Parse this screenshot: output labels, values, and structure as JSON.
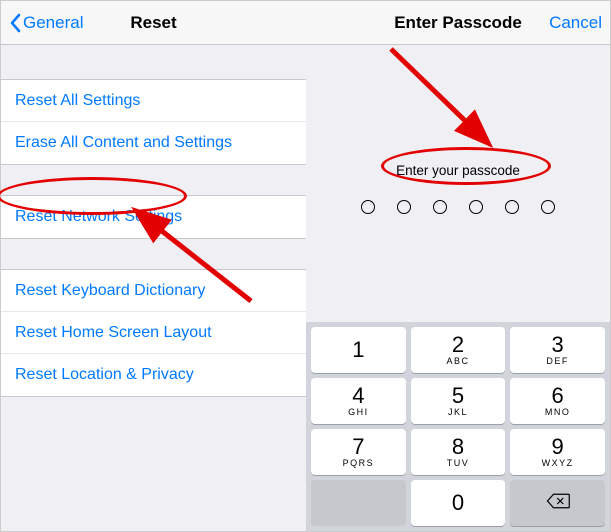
{
  "left": {
    "back_label": "General",
    "title": "Reset",
    "groups": [
      {
        "items": [
          "Reset All Settings",
          "Erase All Content and Settings"
        ]
      },
      {
        "items": [
          "Reset Network Settings"
        ]
      },
      {
        "items": [
          "Reset Keyboard Dictionary",
          "Reset Home Screen Layout",
          "Reset Location & Privacy"
        ]
      }
    ]
  },
  "right": {
    "title": "Enter Passcode",
    "cancel_label": "Cancel",
    "prompt": "Enter your passcode",
    "passcode_length": 6,
    "keypad": [
      {
        "digit": "1",
        "letters": ""
      },
      {
        "digit": "2",
        "letters": "ABC"
      },
      {
        "digit": "3",
        "letters": "DEF"
      },
      {
        "digit": "4",
        "letters": "GHI"
      },
      {
        "digit": "5",
        "letters": "JKL"
      },
      {
        "digit": "6",
        "letters": "MNO"
      },
      {
        "digit": "7",
        "letters": "PQRS"
      },
      {
        "digit": "8",
        "letters": "TUV"
      },
      {
        "digit": "9",
        "letters": "WXYZ"
      },
      {
        "digit": "",
        "letters": ""
      },
      {
        "digit": "0",
        "letters": ""
      },
      {
        "digit": "⌫",
        "letters": ""
      }
    ]
  },
  "annotation_color": "#e20000"
}
